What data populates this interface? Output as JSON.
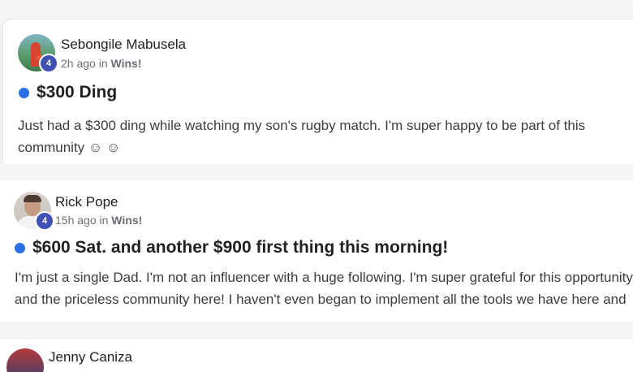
{
  "posts": [
    {
      "author": "Sebongile Mabusela",
      "level": "4",
      "time": "2h ago",
      "in_word": "in",
      "category": "Wins!",
      "title": "$300 Ding",
      "body_lines": [
        "Just had a $300 ding while watching my son's rugby match. I'm super happy to be part of this",
        "community ☺ ☺"
      ]
    },
    {
      "author": "Rick Pope",
      "level": "4",
      "time": "15h ago",
      "in_word": "in",
      "category": "Wins!",
      "title": "$600 Sat. and another $900 first thing this morning!",
      "body_lines": [
        "I'm just a single Dad. I'm not an influencer with a huge following. I'm super grateful for this opportunity",
        "and the priceless community here! I haven't even began to implement all the tools we have here and"
      ]
    },
    {
      "author": "Jenny Caniza"
    }
  ],
  "colors": {
    "unread_dot": "#2b6fe6",
    "level_badge": "#3f51b5",
    "background": "#f4f4f5"
  }
}
